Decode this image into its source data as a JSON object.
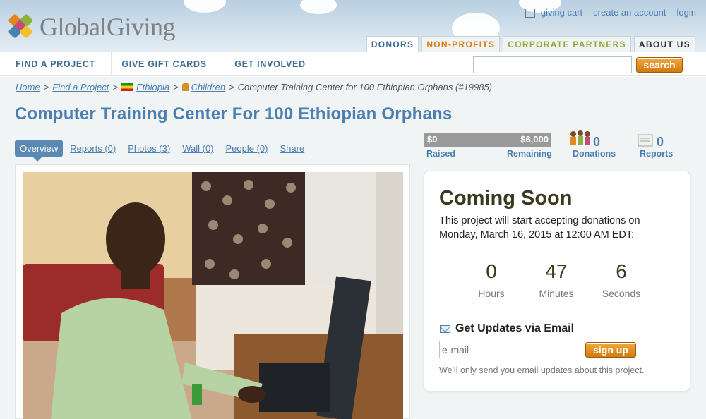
{
  "brand": {
    "name": "GlobalGiving"
  },
  "top_links": {
    "cart": "giving cart",
    "create_account": "create an account",
    "login": "login"
  },
  "audience_tabs": [
    {
      "label": "DONORS",
      "active": true
    },
    {
      "label": "NON-PROFITS"
    },
    {
      "label": "CORPORATE PARTNERS"
    },
    {
      "label": "ABOUT US"
    }
  ],
  "nav": {
    "items": [
      "FIND A PROJECT",
      "GIVE GIFT CARDS",
      "GET INVOLVED"
    ],
    "search_button": "search",
    "search_value": ""
  },
  "breadcrumb": {
    "home": "Home",
    "find": "Find a Project",
    "country": "Ethiopia",
    "theme": "Children",
    "current": "Computer Training Center for 100 Ethiopian Orphans (#19985)",
    "separator": ">"
  },
  "project": {
    "title": "Computer Training Center For 100 Ethiopian Orphans"
  },
  "subtabs": [
    "Overview",
    "Reports (0)",
    "Photos (3)",
    "Wall (0)",
    "People (0)",
    "Share"
  ],
  "stats": {
    "raised_amount": "$0",
    "raised_label": "Raised",
    "remaining_amount": "$6,000",
    "remaining_label": "Remaining",
    "progress_fraction": 0,
    "donations_count": "0",
    "donations_label": "Donations",
    "reports_count": "0",
    "reports_label": "Reports"
  },
  "coming_soon": {
    "title": "Coming Soon",
    "description": "This project will start accepting donations on Monday, March 16, 2015 at 12:00 AM EDT:",
    "countdown": [
      {
        "value": "0",
        "label": "Hours"
      },
      {
        "value": "47",
        "label": "Minutes"
      },
      {
        "value": "6",
        "label": "Seconds"
      }
    ]
  },
  "updates": {
    "title": "Get Updates via Email",
    "email_placeholder": "e-mail",
    "signup_button": "sign up",
    "note": "We'll only send you email updates about this project."
  },
  "colors": {
    "link_blue": "#4b7fb0",
    "orange": "#e08a1e",
    "active_tab": "#5a8ab3",
    "background": "#f1f4f5"
  }
}
